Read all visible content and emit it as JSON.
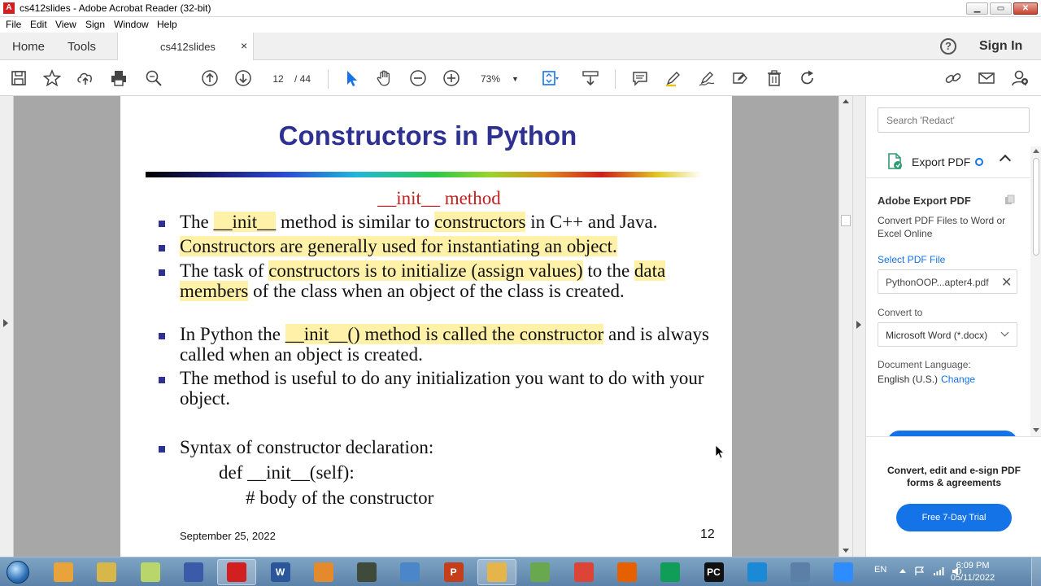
{
  "window": {
    "title": "cs412slides - Adobe Acrobat Reader (32-bit)",
    "app_icon": "acrobat-icon",
    "minimize": "▁",
    "maximize": "▭",
    "close": "✕"
  },
  "menu": [
    "File",
    "Edit",
    "View",
    "Sign",
    "Window",
    "Help"
  ],
  "tabs": {
    "home": "Home",
    "tools": "Tools",
    "document": "cs412slides",
    "close": "×",
    "help": "?",
    "signin": "Sign In"
  },
  "toolbar": {
    "page_current": "12",
    "page_total": "/ 44",
    "zoom": "73%",
    "zoom_arrow": "▼"
  },
  "slide": {
    "title": "Constructors in Python",
    "subheading": "__init__ method",
    "b1": {
      "t1": "The ",
      "h1": "__init__",
      "t2": " method is similar to ",
      "h2": "constructors",
      "t3": " in C++ and Java."
    },
    "b2": {
      "h1": "Constructors are generally used for instantiating an object."
    },
    "b3": {
      "t1": "The task of ",
      "h1": "constructors is to initialize (assign values)",
      "t2": " to the ",
      "h2": "data members",
      "t3": " of the class when an object of the class is created."
    },
    "b4": {
      "t1": "In Python the ",
      "h1": "__init__() method is called the constructor",
      "t2": " and is always called when an object is created."
    },
    "b5": "The method is useful to do any initialization you want to do with your object.",
    "b6": "Syntax of constructor declaration:",
    "code1": "def __init__(self):",
    "code2": "# body of the constructor",
    "date": "September 25, 2022",
    "number": "12"
  },
  "right_pane": {
    "search_placeholder": "Search 'Redact'",
    "export_label": "Export PDF",
    "adobe_export_title": "Adobe Export PDF",
    "description": "Convert PDF Files to Word or Excel Online",
    "select_file_label": "Select PDF File",
    "file_name": "PythonOOP...apter4.pdf",
    "file_remove": "✕",
    "convert_to_label": "Convert to",
    "convert_to_value": "Microsoft Word (*.docx)",
    "doc_language_label": "Document Language:",
    "doc_language_value": "English (U.S.)",
    "change_link": "Change",
    "promo": "Convert, edit and e-sign PDF forms & agreements",
    "trial_button": "Free 7-Day Trial"
  },
  "taskbar": {
    "apps": [
      {
        "icon": "media-player-icon",
        "color": "#e8a33a"
      },
      {
        "icon": "tools-icon",
        "color": "#d7b64a"
      },
      {
        "icon": "sticky-notes-icon",
        "color": "#b8d66a"
      },
      {
        "icon": "infinity-icon",
        "color": "#3b5ba8"
      },
      {
        "icon": "acrobat-reader-icon",
        "color": "#d21f1f"
      },
      {
        "icon": "word-icon",
        "color": "#2b579a"
      },
      {
        "icon": "media-icon",
        "color": "#e58a2c"
      },
      {
        "icon": "terminal-icon",
        "color": "#3f4a3a"
      },
      {
        "icon": "vm-icon",
        "color": "#4a86c8"
      },
      {
        "icon": "powerpoint-icon",
        "color": "#c43e1c"
      },
      {
        "icon": "file-explorer-icon",
        "color": "#e5b54b"
      },
      {
        "icon": "notepad-icon",
        "color": "#6aa84f"
      },
      {
        "icon": "chrome-icon",
        "color": "#db4437"
      },
      {
        "icon": "firefox-icon",
        "color": "#e66000"
      },
      {
        "icon": "chrome-alt-icon",
        "color": "#0f9d58"
      },
      {
        "icon": "pycharm-icon",
        "color": "#111111"
      },
      {
        "icon": "edge-icon",
        "color": "#1b8ad6"
      },
      {
        "icon": "remote-desktop-icon",
        "color": "#5b7fa6"
      },
      {
        "icon": "zoom-icon",
        "color": "#2d8cff"
      }
    ],
    "active": [
      4,
      10
    ],
    "letters": [
      "",
      "",
      "",
      "",
      "",
      "W",
      "",
      "",
      "",
      "P",
      "",
      "",
      "",
      "",
      "",
      "PC",
      "",
      "",
      ""
    ],
    "lang": "EN",
    "time": "6:09 PM",
    "date": "05/11/2022"
  }
}
